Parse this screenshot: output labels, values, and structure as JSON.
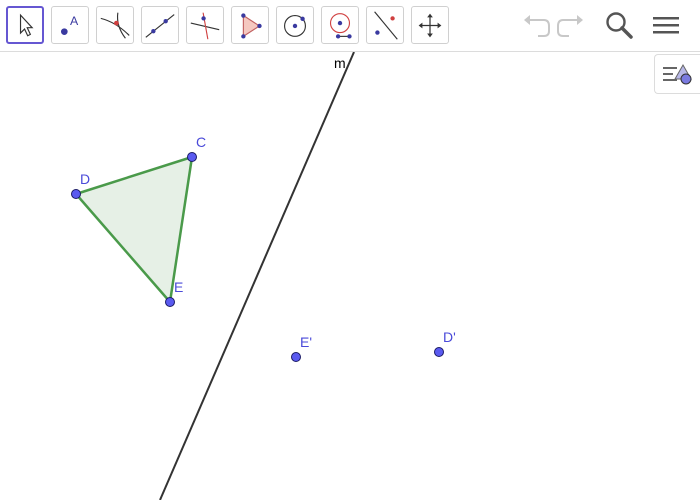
{
  "toolbar": {
    "tools": [
      {
        "name": "move-tool-button",
        "icon": "arrow-pointer-icon",
        "selected": true
      },
      {
        "name": "point-tool-button",
        "icon": "point-icon",
        "selected": false
      },
      {
        "name": "intersect-tool-button",
        "icon": "intersect-icon",
        "selected": false
      },
      {
        "name": "line-tool-button",
        "icon": "line-through-points-icon",
        "selected": false
      },
      {
        "name": "perpendicular-line-tool-button",
        "icon": "perpendicular-line-icon",
        "selected": false
      },
      {
        "name": "polygon-tool-button",
        "icon": "polygon-icon",
        "selected": false
      },
      {
        "name": "circle-tool-button",
        "icon": "circle-center-point-icon",
        "selected": false
      },
      {
        "name": "circle-radius-tool-button",
        "icon": "circle-radius-icon",
        "selected": false
      },
      {
        "name": "reflect-tool-button",
        "icon": "reflect-about-line-icon",
        "selected": false
      },
      {
        "name": "move-graphics-view-button",
        "icon": "move-arrows-icon",
        "selected": false
      }
    ],
    "undo_icon": "undo-icon",
    "redo_icon": "redo-icon",
    "search_icon": "search-icon",
    "menu_icon": "hamburger-menu-icon",
    "style_bar_icon": "style-bar-icon"
  },
  "colors": {
    "point": "#5a5af0",
    "point_stroke": "#1a1a66",
    "label": "#4a4ad9",
    "polygon_stroke": "#4a9a4a",
    "polygon_fill": "#e6f0e6",
    "line": "#333333",
    "selected_border": "#6557d2"
  },
  "construction": {
    "points": [
      {
        "label": "C"
      },
      {
        "label": "D"
      },
      {
        "label": "E"
      },
      {
        "label": "E'"
      },
      {
        "label": "D'"
      }
    ],
    "line": {
      "label": "m"
    }
  }
}
